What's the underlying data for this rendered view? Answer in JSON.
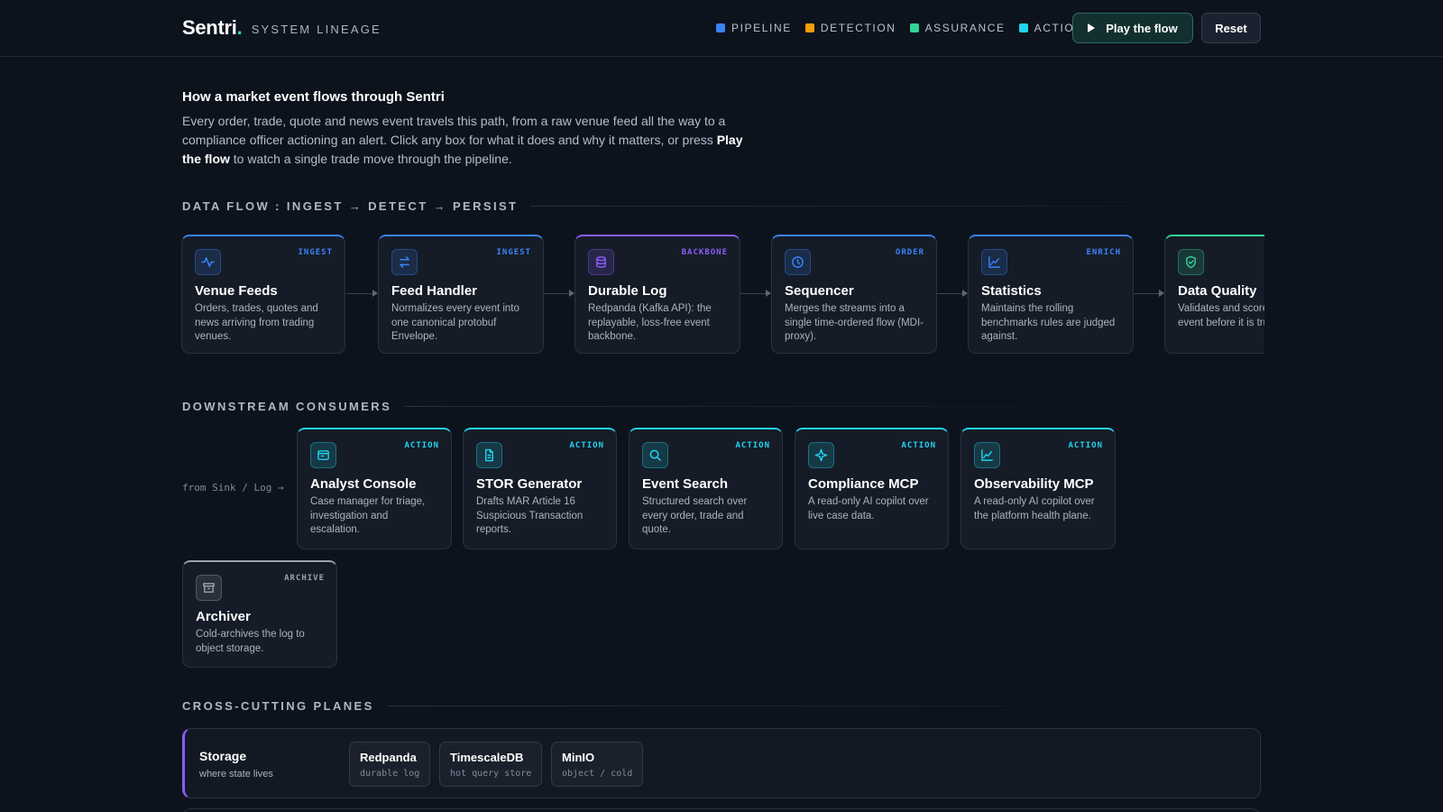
{
  "header": {
    "brand": "Sentri",
    "brand_dot": ".",
    "subtitle": "SYSTEM LINEAGE",
    "legend": [
      {
        "label": "PIPELINE",
        "color": "#3b82f6"
      },
      {
        "label": "DETECTION",
        "color": "#f59e0b"
      },
      {
        "label": "ASSURANCE",
        "color": "#34d399"
      },
      {
        "label": "ACTION",
        "color": "#22d3ee"
      }
    ],
    "play_label": "Play the flow",
    "reset_label": "Reset"
  },
  "intro": {
    "title": "How a market event flows through Sentri",
    "text_before": "Every order, trade, quote and news event travels this path, from a raw venue feed all the way to a compliance officer actioning an alert. Click any box for what it does and why it matters, or press ",
    "text_bold": "Play the flow",
    "text_after": " to watch a single trade move through the pipeline."
  },
  "sections": {
    "data_flow": "DATA FLOW : INGEST → DETECT → PERSIST",
    "downstream": "DOWNSTREAM CONSUMERS",
    "planes": "CROSS-CUTTING PLANES"
  },
  "pipeline": [
    {
      "tag": "INGEST",
      "title": "Venue Feeds",
      "desc": "Orders, trades, quotes and news arriving from trading venues.",
      "icon": "activity-icon",
      "color": "#3b82f6"
    },
    {
      "tag": "INGEST",
      "title": "Feed Handler",
      "desc": "Normalizes every event into one canonical protobuf Envelope.",
      "icon": "swap-icon",
      "color": "#3b82f6"
    },
    {
      "tag": "BACKBONE",
      "title": "Durable Log",
      "desc": "Redpanda (Kafka API): the replayable, loss-free event backbone.",
      "icon": "database-icon",
      "color": "#8b5cf6"
    },
    {
      "tag": "ORDER",
      "title": "Sequencer",
      "desc": "Merges the streams into a single time-ordered flow (MDI-proxy).",
      "icon": "clock-icon",
      "color": "#3b82f6"
    },
    {
      "tag": "ENRICH",
      "title": "Statistics",
      "desc": "Maintains the rolling benchmarks rules are judged against.",
      "icon": "chart-icon",
      "color": "#3b82f6"
    },
    {
      "tag": "",
      "title": "Data Quality",
      "desc": "Validates and scores each event before it is trusted.",
      "icon": "shield-icon",
      "color": "#34d399"
    }
  ],
  "downstream_from": "from Sink / Log →",
  "consumers": [
    {
      "tag": "ACTION",
      "title": "Analyst Console",
      "desc": "Case manager for triage, investigation and escalation.",
      "icon": "window-icon",
      "color": "#22d3ee"
    },
    {
      "tag": "ACTION",
      "title": "STOR Generator",
      "desc": "Drafts MAR Article 16 Suspicious Transaction reports.",
      "icon": "document-icon",
      "color": "#22d3ee"
    },
    {
      "tag": "ACTION",
      "title": "Event Search",
      "desc": "Structured search over every order, trade and quote.",
      "icon": "search-icon",
      "color": "#22d3ee"
    },
    {
      "tag": "ACTION",
      "title": "Compliance MCP",
      "desc": "A read-only AI copilot over live case data.",
      "icon": "sparkle-icon",
      "color": "#22d3ee"
    },
    {
      "tag": "ACTION",
      "title": "Observability MCP",
      "desc": "A read-only AI copilot over the platform health plane.",
      "icon": "chart-icon",
      "color": "#22d3ee"
    }
  ],
  "archiver": {
    "tag": "ARCHIVE",
    "title": "Archiver",
    "desc": "Cold-archives the log to object storage.",
    "icon": "archive-icon",
    "color": "#9aa3ae"
  },
  "planes": [
    {
      "title": "Storage",
      "sub": "where state lives",
      "color": "#8b5cf6",
      "chips": [
        {
          "name": "Redpanda",
          "sub": "durable log"
        },
        {
          "name": "TimescaleDB",
          "sub": "hot query store"
        },
        {
          "name": "MinIO",
          "sub": "object / cold"
        }
      ]
    }
  ]
}
